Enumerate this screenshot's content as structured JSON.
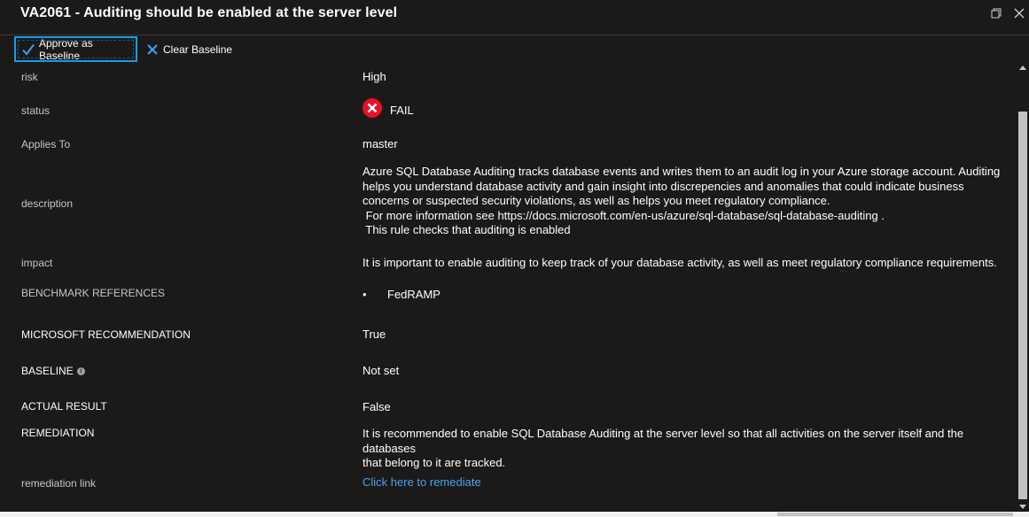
{
  "window": {
    "title": "VA2061 - Auditing should be enabled at the server level",
    "restore_icon": "restore-icon",
    "close_icon": "close-icon"
  },
  "toolbar": {
    "approve_label": "Approve as Baseline",
    "approve_icon": "checkmark-icon",
    "clear_label": "Clear Baseline",
    "clear_icon": "x-icon"
  },
  "details": {
    "risk": {
      "label": "risk",
      "value": "High"
    },
    "status": {
      "label": "status",
      "value": "FAIL",
      "icon": "fail-icon",
      "icon_color": "#e81123"
    },
    "applies_to": {
      "label": "Applies To",
      "value": "master"
    },
    "description": {
      "label": "description",
      "lines": [
        "Azure SQL Database Auditing tracks database events and writes them to an audit log in your Azure storage account. Auditing",
        "helps you understand database activity and gain insight into discrepencies and anomalies that could indicate business",
        "concerns or suspected security violations, as well as helps you meet regulatory compliance.",
        " For more information see https://docs.microsoft.com/en-us/azure/sql-database/sql-database-auditing .",
        " This rule checks that auditing is enabled"
      ]
    },
    "impact": {
      "label": "impact",
      "value": "It is important to enable auditing to keep track of your database activity, as well as meet regulatory compliance requirements."
    },
    "benchmark_references": {
      "label": "BENCHMARK REFERENCES",
      "items": [
        "FedRAMP"
      ]
    },
    "microsoft_recommendation": {
      "label": "MICROSOFT RECOMMENDATION",
      "value": "True"
    },
    "baseline": {
      "label": "BASELINE",
      "value": "Not set",
      "info_icon": "info-icon"
    },
    "actual_result": {
      "label": "ACTUAL RESULT",
      "value": "False"
    },
    "remediation": {
      "label": "REMEDIATION",
      "lines": [
        "It is recommended to enable SQL Database Auditing at the server level so that all activities on the server itself and the databases",
        "that belong to it are tracked."
      ]
    },
    "remediation_link": {
      "label": "remediation link",
      "value": "Click here to remediate"
    }
  },
  "colors": {
    "background": "#1b1a19",
    "accent": "#1a9be6",
    "link": "#4aa3f0",
    "fail": "#e81123"
  }
}
